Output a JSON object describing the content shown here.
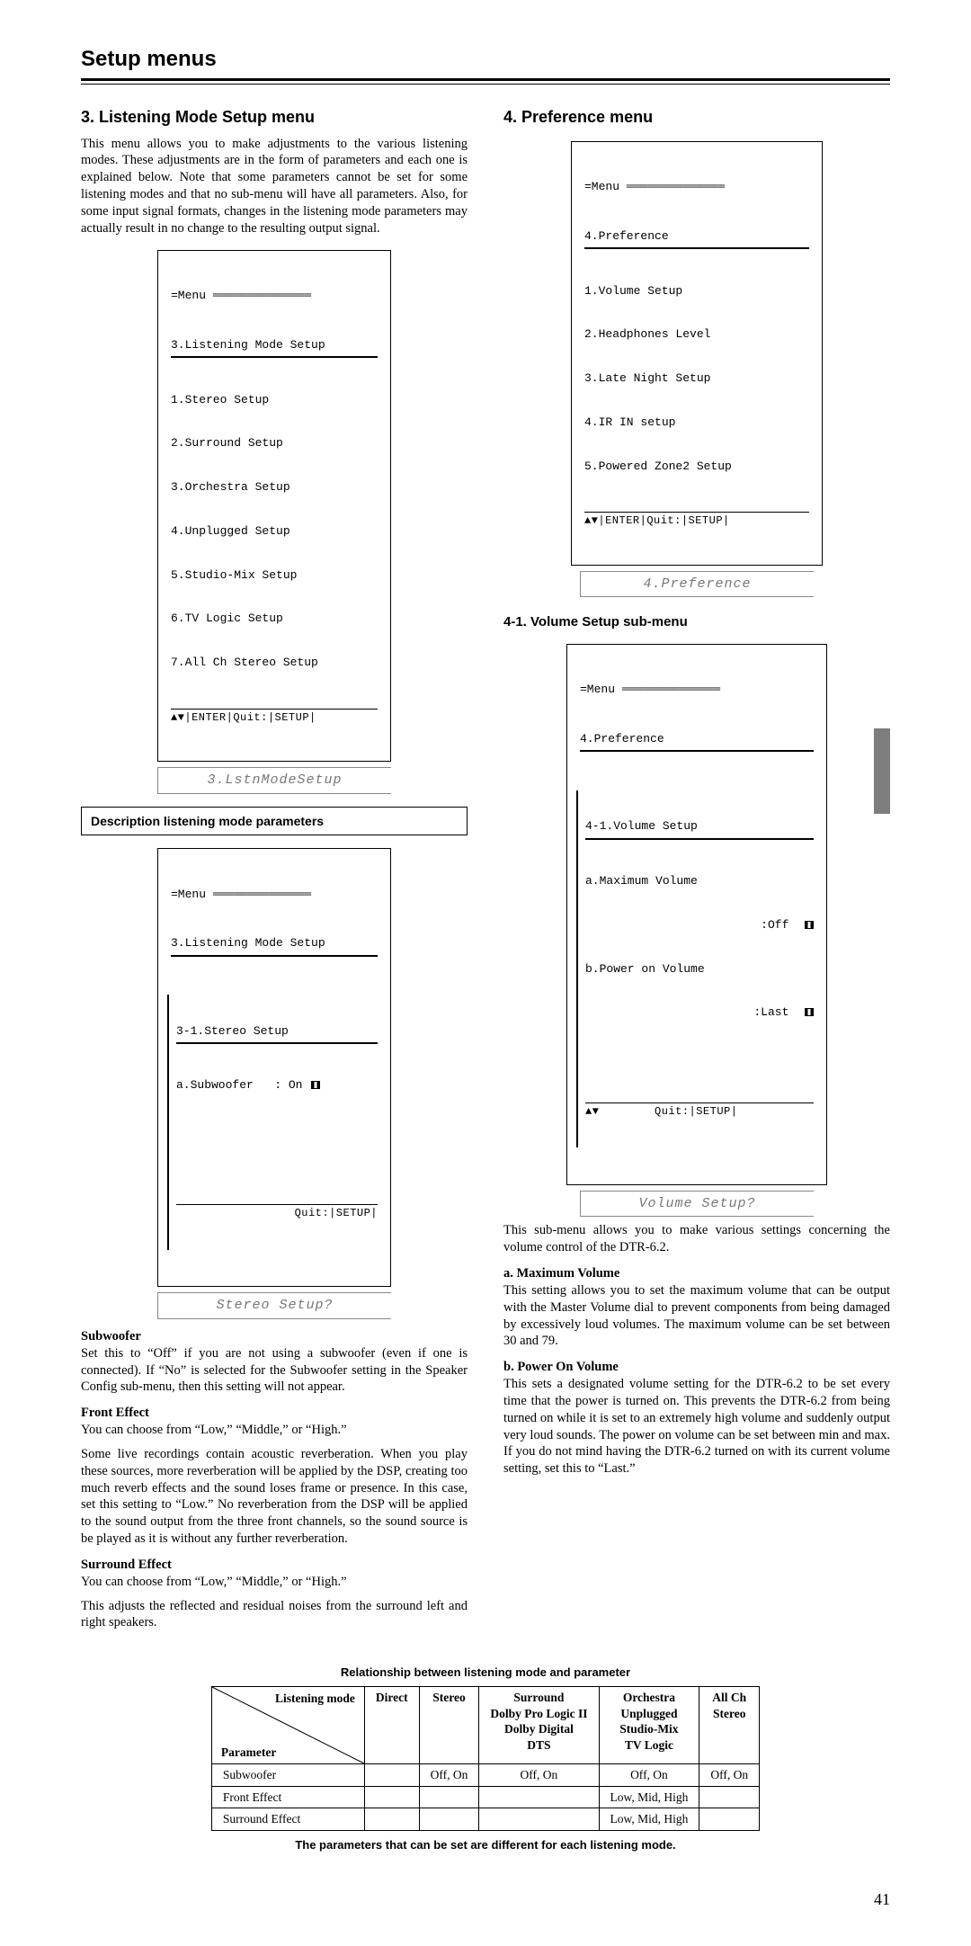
{
  "page_title": "Setup menus",
  "page_number": "41",
  "section3": {
    "heading": "3. Listening Mode Setup menu",
    "intro": "This menu allows you to make adjustments to the various listening modes. These adjustments are in the form of parameters and each one is explained below. Note that some parameters cannot be set for some listening modes and that no sub-menu will have all parameters. Also, for some input signal formats, changes in the listening mode parameters may actually result in no change to the resulting output signal.",
    "osd_menu_label": "=Menu",
    "osd_title": "3.Listening Mode Setup",
    "osd_items": [
      "1.Stereo Setup",
      "2.Surround Setup",
      "3.Orchestra Setup",
      "4.Unplugged Setup",
      "5.Studio-Mix Setup",
      "6.TV Logic Setup",
      "7.All Ch Stereo Setup"
    ],
    "osd_footer": "|ENTER|Quit:|SETUP|",
    "lcd": "3.LstnModeSetup",
    "desc_heading": "Description listening mode parameters",
    "osd2_title": "3.Listening Mode Setup",
    "osd2_sub": "3-1.Stereo Setup",
    "osd2_param_label": "a.Subwoofer",
    "osd2_param_value": ": On",
    "osd2_footer": "Quit:|SETUP|",
    "lcd2": "Stereo Setup?",
    "subwoofer_h": "Subwoofer",
    "subwoofer_p": "Set this to “Off” if you are not using a subwoofer (even if one is connected). If “No” is selected for the Subwoofer setting in the Speaker Config sub-menu, then this setting will not appear.",
    "front_h": "Front Effect",
    "front_p1": "You can choose from “Low,” “Middle,” or “High.”",
    "front_p2": "Some live recordings contain acoustic reverberation. When you play these sources, more reverberation will be applied by the DSP, creating too much reverb effects and the sound loses frame or presence. In this case, set this setting to “Low.” No reverberation from the DSP will be applied to the sound output from the three front channels, so the sound source is be played as it is without any further reverberation.",
    "surround_h": "Surround Effect",
    "surround_p1": "You can choose from “Low,” “Middle,” or “High.”",
    "surround_p2": "This adjusts the reflected and residual noises from the surround left and right speakers."
  },
  "section4": {
    "heading": "4. Preference menu",
    "osd_title": "4.Preference",
    "osd_items": [
      "1.Volume Setup",
      "2.Headphones Level",
      "3.Late Night Setup",
      "4.IR IN setup",
      "5.Powered Zone2 Setup"
    ],
    "osd_footer": "|ENTER|Quit:|SETUP|",
    "lcd": "4.Preference",
    "sub_heading": "4-1. Volume Setup sub-menu",
    "osd2_title": "4.Preference",
    "osd2_sub": "4-1.Volume Setup",
    "osd2_a_label": "a.Maximum Volume",
    "osd2_a_value": ":Off",
    "osd2_b_label": "b.Power on Volume",
    "osd2_b_value": ":Last",
    "osd2_footer": "Quit:|SETUP|",
    "lcd2": "Volume Setup?",
    "vol_intro": "This sub-menu allows you to make various settings concerning the volume control of the DTR-6.2.",
    "max_h": "a. Maximum Volume",
    "max_p": "This setting allows you to set the maximum volume that can be output with the Master Volume dial to prevent components from being damaged by excessively loud volumes. The maximum volume can be set between 30 and 79.",
    "pow_h": "b. Power On Volume",
    "pow_p": "This sets a designated volume setting for the DTR-6.2 to be set every time that the power is turned on. This prevents the DTR-6.2 from being turned on while it is set to an extremely high volume and suddenly output very loud sounds. The power on volume can be set between min and max. If you do not mind having the DTR-6.2 turned on with its current volume setting, set this to “Last.”"
  },
  "table": {
    "caption": "Relationship between listening mode and parameter",
    "diag_top": "Listening mode",
    "diag_bottom": "Parameter",
    "cols": {
      "direct": "Direct",
      "stereo": "Stereo",
      "surround_h": "Surround",
      "surround_l1": "Dolby Pro Logic II",
      "surround_l2": "Dolby Digital",
      "surround_l3": "DTS",
      "orch_h": "Orchestra",
      "orch_l1": "Unplugged",
      "orch_l2": "Studio-Mix",
      "orch_l3": "TV Logic",
      "all_h": "All Ch",
      "all_l": "Stereo"
    },
    "rows": {
      "sub": {
        "label": "Subwoofer",
        "direct": "",
        "stereo": "Off, On",
        "surround": "Off, On",
        "orch": "Off, On",
        "all": "Off, On"
      },
      "fe": {
        "label": "Front Effect",
        "direct": "",
        "stereo": "",
        "surround": "",
        "orch": "Low, Mid, High",
        "all": ""
      },
      "se": {
        "label": "Surround Effect",
        "direct": "",
        "stereo": "",
        "surround": "",
        "orch": "Low, Mid, High",
        "all": ""
      }
    },
    "foot": "The parameters that can be set are different for each listening mode."
  },
  "nav_arrow_glyph": "▲▼"
}
